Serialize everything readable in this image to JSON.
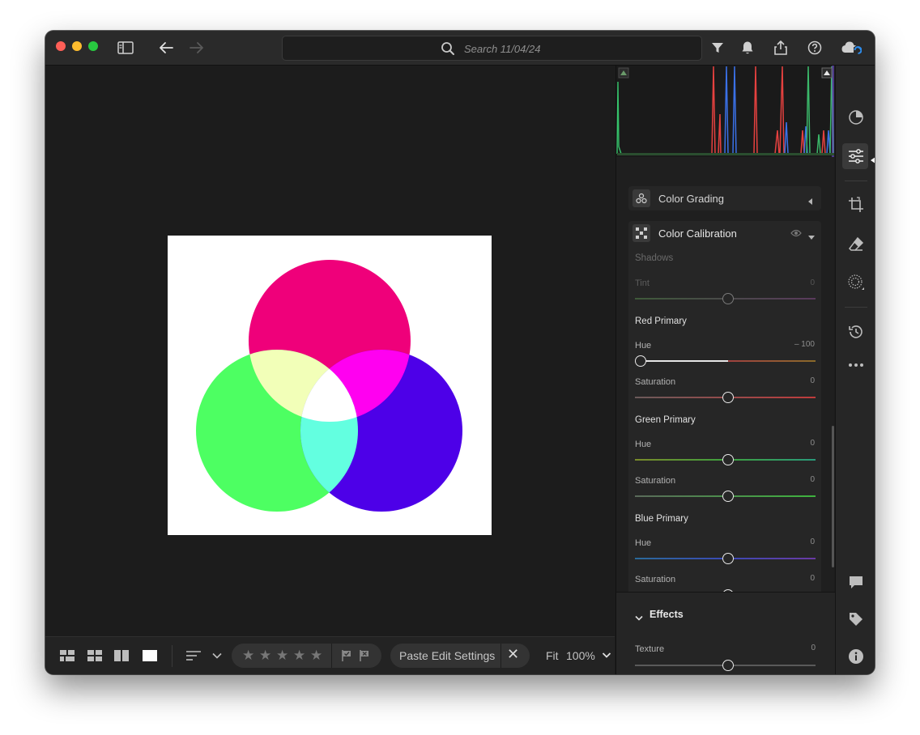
{
  "search": {
    "placeholder": "Search 11/04/24"
  },
  "toolbar": {
    "fit_label": "Fit",
    "zoom_label": "100%",
    "paste_label": "Paste Edit Settings",
    "rating_stars": 5
  },
  "panel": {
    "color_grading": {
      "title": "Color Grading"
    },
    "color_calibration": {
      "title": "Color Calibration",
      "shadows": {
        "title": "Shadows",
        "tint": {
          "label": "Tint",
          "value": "0",
          "position": 0.5
        }
      },
      "red_primary": {
        "title": "Red Primary",
        "hue": {
          "label": "Hue",
          "value": "– 100",
          "position": 0.0
        },
        "saturation": {
          "label": "Saturation",
          "value": "0",
          "position": 0.5
        }
      },
      "green_primary": {
        "title": "Green Primary",
        "hue": {
          "label": "Hue",
          "value": "0",
          "position": 0.5
        },
        "saturation": {
          "label": "Saturation",
          "value": "0",
          "position": 0.5
        }
      },
      "blue_primary": {
        "title": "Blue Primary",
        "hue": {
          "label": "Hue",
          "value": "0",
          "position": 0.5
        },
        "saturation": {
          "label": "Saturation",
          "value": "0",
          "position": 0.5
        }
      }
    },
    "effects": {
      "title": "Effects",
      "texture": {
        "label": "Texture",
        "value": "0",
        "position": 0.5
      }
    }
  },
  "colors": {
    "accent": "#1473e6",
    "red_circle": "#ef007a",
    "green_circle": "#4dff62",
    "blue_circle": "#4d00e8",
    "overlap_rg": "#f2ffb8",
    "overlap_rb": "#ff00f0",
    "overlap_gb": "#63ffe0"
  },
  "icons": {
    "titlebar": [
      "sidebar-toggle-icon",
      "back-arrow-icon",
      "forward-arrow-icon",
      "search-icon",
      "filter-icon",
      "bell-icon",
      "share-icon",
      "help-icon",
      "cloud-sync-icon"
    ],
    "rail": [
      "presets-icon",
      "edit-sliders-icon",
      "crop-icon",
      "healing-eraser-icon",
      "masking-icon",
      "history-icon",
      "more-icon",
      "comment-icon",
      "tag-icon",
      "info-icon"
    ]
  }
}
